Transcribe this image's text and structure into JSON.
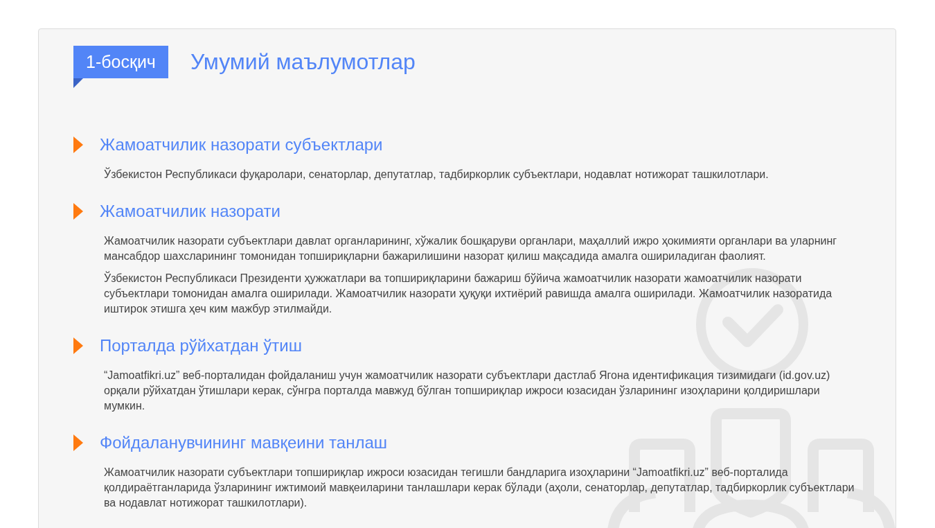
{
  "step": {
    "badge": "1-босқич",
    "title": "Умумий маълумотлар"
  },
  "sections": [
    {
      "heading": "Жамоатчилик назорати субъектлари",
      "paragraphs": [
        "Ўзбекистон Республикаси фуқаролари, сенаторлар, депутатлар, тадбиркорлик субъектлари, нодавлат нотижорат ташкилотлари."
      ]
    },
    {
      "heading": "Жамоатчилик назорати",
      "paragraphs": [
        "Жамоатчилик назорати субъектлари давлат органларининг, хўжалик бошқаруви органлари, маҳаллий ижро ҳокимияти органлари ва уларнинг мансабдор шахсларининг томонидан топшириқларни бажарилишини назорат қилиш мақсадида амалга ошириладиган фаолият.",
        "Ўзбекистон Республикаси Президенти ҳужжатлари ва топшириқларини бажариш бўйича жамоатчилик назорати жамоатчилик назорати субъектлари томонидан амалга оширилади. Жамоатчилик назорати ҳуқуқи ихтиёрий равишда амалга оширилади. Жамоатчилик назоратида иштирок этишга ҳеч ким мажбур этилмайди."
      ]
    },
    {
      "heading": "Порталда рўйхатдан ўтиш",
      "paragraphs": [
        "“Jamoatfikri.uz” веб-порталидан фойдаланиш учун жамоатчилик назорати субъектлари дастлаб Ягона идентификация тизимидаги (id.gov.uz) орқали рўйхатдан ўтишлари керак, сўнгра порталда мавжуд бўлган топшириқлар ижроси юзасидан ўзларининг изоҳларини қолдиришлари мумкин."
      ]
    },
    {
      "heading": "Фойдаланувчининг мавқеини танлаш",
      "paragraphs": [
        "Жамоатчилик назорати субъектлари топшириқлар ижроси юзасидан тегишли бандларига изоҳларини “Jamoatfikri.uz” веб-порталида қолдираётганларида ўзларининг ижтимоий мавқеиларини танлашлари керак бўлади (аҳоли, сенаторлар, депутатлар, тадбиркорлик субъектлари ва нодавлат нотижорат ташкилотлари)."
      ]
    }
  ]
}
